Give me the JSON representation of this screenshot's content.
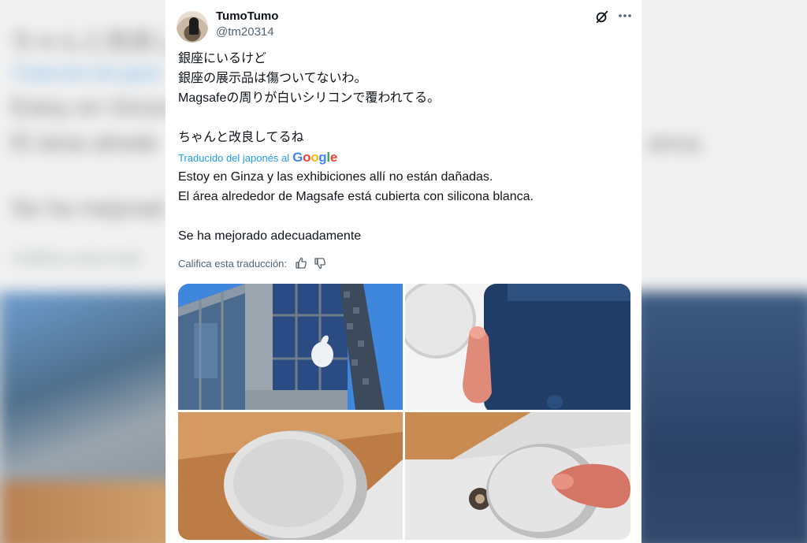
{
  "tweet": {
    "display_name": "TumoTumo",
    "handle": "@tm20314",
    "text_jp": [
      "銀座にいるけど",
      "銀座の展示品は傷ついてないわ。",
      "Magsafeの周りが白いシリコンで覆われてる。",
      "",
      "ちゃんと改良してるね"
    ],
    "translation_label": "Traducido del japonés al",
    "translation_provider": "Google",
    "text_es": [
      "Estoy en Ginza y las exhibiciones allí no están dañadas.",
      "El área alrededor de Magsafe está cubierta con silicona blanca.",
      "",
      "Se ha mejorado adecuadamente"
    ],
    "rate_prompt": "Califica esta traducción:"
  },
  "background_text": {
    "line1": "ちゃんと改良し",
    "line2": "Traducido del japon",
    "line3": "Estoy en Ginza",
    "line4": "El área alrede",
    "line4_right": "anca.",
    "line5": "Se ha mejorad",
    "line6": "Califica esta trad"
  },
  "icons": {
    "grok": "grok-icon",
    "more": "more-icon",
    "thumbs_up": "thumbs-up-icon",
    "thumbs_down": "thumbs-down-icon"
  },
  "media": [
    "apple-store-building-photo",
    "iphone-magsafe-photo",
    "magsafe-charger-photo",
    "magsafe-charger-lifted-photo"
  ],
  "colors": {
    "link_blue": "#1d9bf0",
    "text_primary": "#0f1419",
    "text_secondary": "#536471"
  }
}
